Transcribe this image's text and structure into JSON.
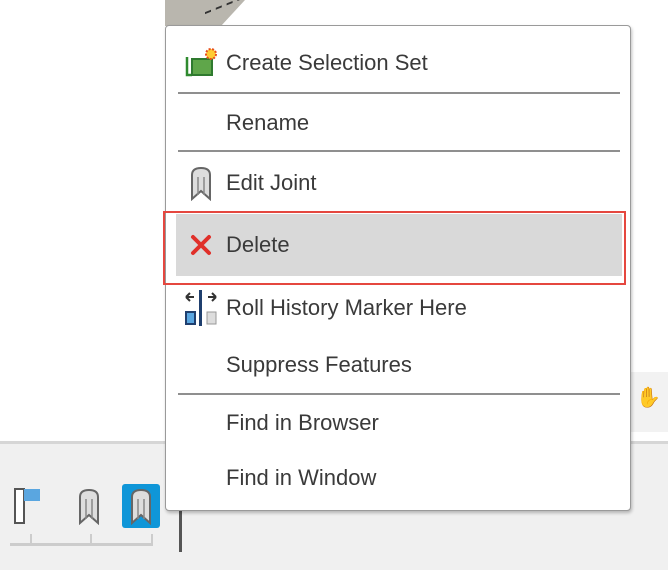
{
  "menu": {
    "items": [
      {
        "label": "Create Selection Set",
        "icon": "create-selection-set-icon"
      },
      {
        "label": "Rename",
        "icon": null
      },
      {
        "label": "Edit Joint",
        "icon": "joint-icon"
      },
      {
        "label": "Delete",
        "icon": "delete-x-icon",
        "highlighted": true
      },
      {
        "label": "Roll History Marker Here",
        "icon": "roll-history-marker-icon"
      },
      {
        "label": "Suppress Features",
        "icon": null
      },
      {
        "label": "Find in Browser",
        "icon": null
      },
      {
        "label": "Find in Window",
        "icon": null
      }
    ]
  },
  "colors": {
    "highlight": "#d9d9d9",
    "annotation": "#e5473f",
    "timeline_active": "#0f96d8"
  }
}
